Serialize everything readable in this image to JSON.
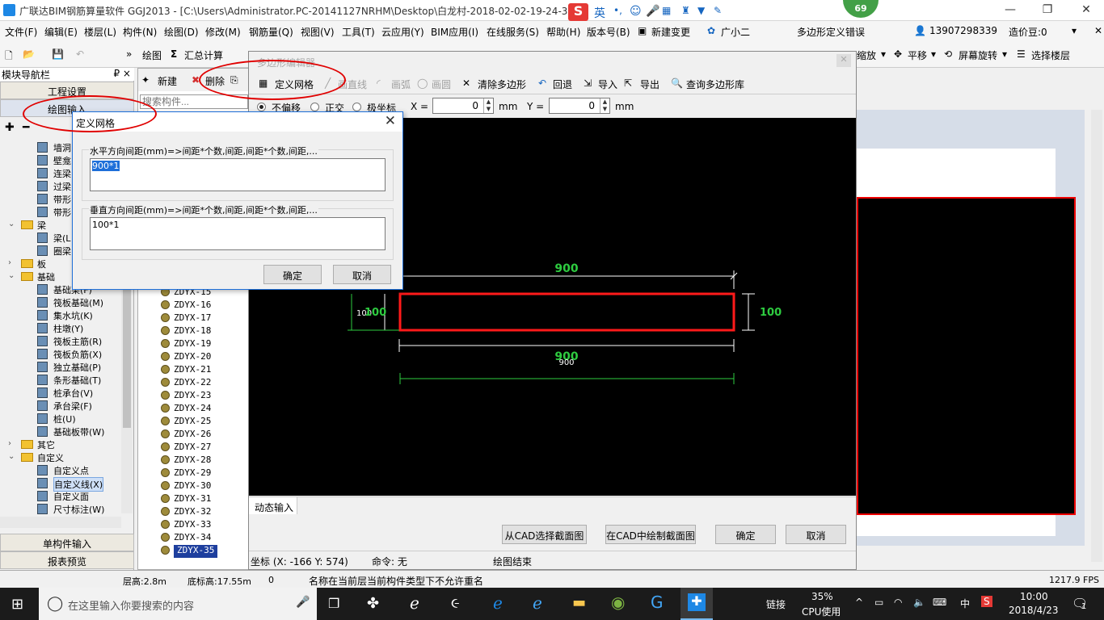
{
  "titlebar": {
    "title": "广联达BIM钢筋算量软件 GGJ2013 - [C:\\Users\\Administrator.PC-20141127NRHM\\Desktop\\白龙村-2018-02-02-19-24-35",
    "badge": "69",
    "ime": {
      "s_label": "S",
      "lang": "英"
    }
  },
  "menubar": {
    "items": [
      "文件(F)",
      "编辑(E)",
      "楼层(L)",
      "构件(N)",
      "绘图(D)",
      "修改(M)",
      "钢筋量(Q)",
      "视图(V)",
      "工具(T)",
      "云应用(Y)",
      "BIM应用(I)",
      "在线服务(S)",
      "帮助(H)",
      "版本号(B)",
      "新建变更",
      "广小二"
    ],
    "error_text": "多边形定义错误",
    "phone": "13907298339",
    "price_beans": "造价豆:0"
  },
  "toolbar": {
    "draw": "绘图",
    "sum": "汇总计算",
    "zoom": "缩放",
    "pan": "平移",
    "rotate": "屏幕旋转",
    "select_floor": "选择楼层"
  },
  "leftnav": {
    "header": "模块导航栏",
    "pin": "₽ ×",
    "project_settings": "工程设置",
    "drawing_input": "绘图输入",
    "single_input": "单构件输入",
    "report_preview": "报表预览",
    "tree": [
      {
        "label": "墙洞",
        "indent": 2
      },
      {
        "label": "壁龛",
        "indent": 2
      },
      {
        "label": "连梁",
        "indent": 2
      },
      {
        "label": "过梁",
        "indent": 2
      },
      {
        "label": "带形",
        "indent": 2
      },
      {
        "label": "带形",
        "indent": 2
      },
      {
        "label": "梁",
        "indent": 1,
        "folder": true,
        "expanded": true
      },
      {
        "label": "梁(L",
        "indent": 2
      },
      {
        "label": "圈梁",
        "indent": 2
      },
      {
        "label": "板",
        "indent": 1,
        "folder": true,
        "expanded": false
      },
      {
        "label": "基础",
        "indent": 1,
        "folder": true,
        "expanded": true
      },
      {
        "label": "基础梁(F)",
        "indent": 2
      },
      {
        "label": "筏板基础(M)",
        "indent": 2
      },
      {
        "label": "集水坑(K)",
        "indent": 2
      },
      {
        "label": "柱墩(Y)",
        "indent": 2
      },
      {
        "label": "筏板主筋(R)",
        "indent": 2
      },
      {
        "label": "筏板负筋(X)",
        "indent": 2
      },
      {
        "label": "独立基础(P)",
        "indent": 2
      },
      {
        "label": "条形基础(T)",
        "indent": 2
      },
      {
        "label": "桩承台(V)",
        "indent": 2
      },
      {
        "label": "承台梁(F)",
        "indent": 2
      },
      {
        "label": "桩(U)",
        "indent": 2
      },
      {
        "label": "基础板带(W)",
        "indent": 2
      },
      {
        "label": "其它",
        "indent": 1,
        "folder": true,
        "expanded": false
      },
      {
        "label": "自定义",
        "indent": 1,
        "folder": true,
        "expanded": true
      },
      {
        "label": "自定义点",
        "indent": 2
      },
      {
        "label": "自定义线(X)",
        "indent": 2,
        "selected": true
      },
      {
        "label": "自定义面",
        "indent": 2
      },
      {
        "label": "尺寸标注(W)",
        "indent": 2
      }
    ]
  },
  "complist": {
    "new": "新建",
    "delete": "删除",
    "search_placeholder": "搜索构件...",
    "items": [
      "ZDYX-15",
      "ZDYX-16",
      "ZDYX-17",
      "ZDYX-18",
      "ZDYX-19",
      "ZDYX-20",
      "ZDYX-21",
      "ZDYX-22",
      "ZDYX-23",
      "ZDYX-24",
      "ZDYX-25",
      "ZDYX-26",
      "ZDYX-27",
      "ZDYX-28",
      "ZDYX-29",
      "ZDYX-30",
      "ZDYX-31",
      "ZDYX-32",
      "ZDYX-33",
      "ZDYX-34",
      "ZDYX-35"
    ],
    "selected": "ZDYX-35"
  },
  "polydlg": {
    "title": "多边形编辑器",
    "tools": {
      "define_grid": "定义网格",
      "line": "画直线",
      "arc": "画弧",
      "circle": "画圆",
      "clear": "清除多边形",
      "undo": "回退",
      "import": "导入",
      "export": "导出",
      "query": "查询多边形库"
    },
    "options": {
      "no_offset": "不偏移",
      "ortho": "正交",
      "polar": "极坐标",
      "x_label": "X =",
      "y_label": "Y =",
      "x_value": "0",
      "y_value": "0",
      "unit": "mm"
    },
    "canvas": {
      "dim_top": "900",
      "dim_bottom": "900",
      "dim_bottom_small": "900",
      "dim_left": "100",
      "dim_left_small": "100",
      "dim_right": "100"
    },
    "dyn_input": "动态输入",
    "btn_cad_select": "从CAD选择截面图",
    "btn_cad_draw": "在CAD中绘制截面图",
    "btn_ok": "确定",
    "btn_cancel": "取消",
    "status": {
      "coord": "坐标 (X: -166 Y: 574)",
      "cmd": "命令: 无",
      "state": "绘图结束"
    }
  },
  "griddlg": {
    "title": "定义网格",
    "h_label": "水平方向间距(mm)=>间距*个数,间距,间距*个数,间距,...",
    "h_value": "900*1",
    "v_label": "垂直方向间距(mm)=>间距*个数,间距,间距*个数,间距,...",
    "v_value": "100*1",
    "ok": "确定",
    "cancel": "取消"
  },
  "statusbar": {
    "floor_height": "层高:2.8m",
    "bottom_height": "底标高:17.55m",
    "zero": "0",
    "message": "名称在当前层当前构件类型下不允许重名",
    "fps": "1217.9 FPS"
  },
  "taskbar": {
    "search_placeholder": "在这里输入你要搜索的内容",
    "link": "链接",
    "cpu_pct": "35%",
    "cpu_label": "CPU使用",
    "ime_zh": "中",
    "time": "10:00",
    "date": "2018/4/23",
    "notif": "1"
  },
  "colors": {
    "canvas_bg": "#000000",
    "rect_stroke": "#ff1a1a",
    "dim_green": "#2ecc40",
    "annotation_red": "#e00000",
    "selection_blue": "#1e3f9e"
  }
}
